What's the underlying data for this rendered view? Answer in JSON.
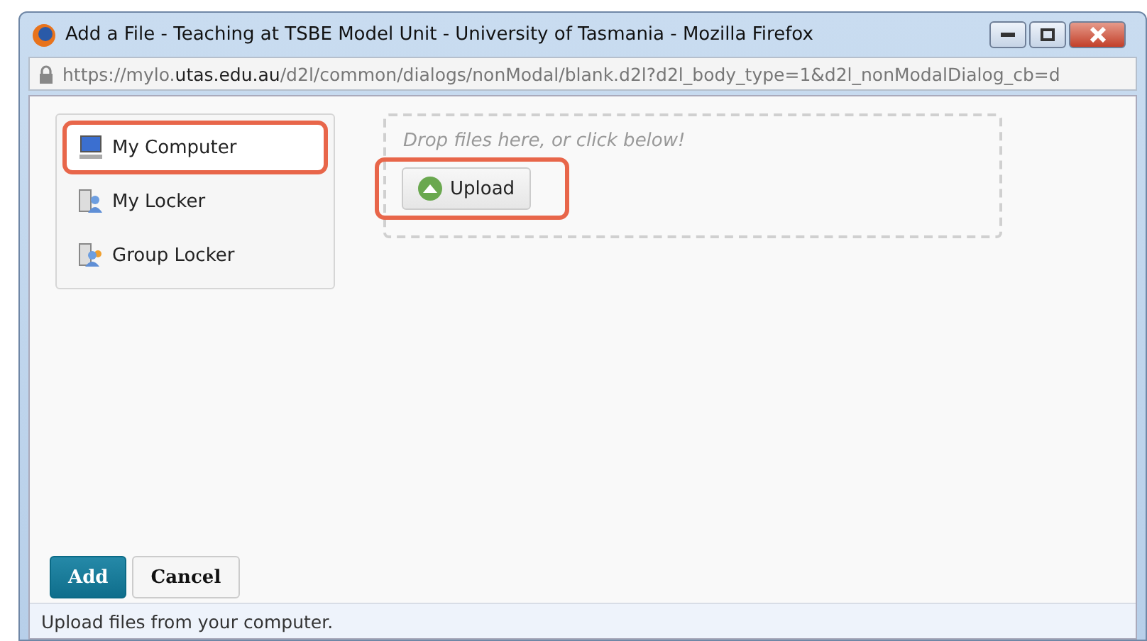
{
  "window": {
    "title": "Add a File - Teaching at TSBE Model Unit - University of Tasmania - Mozilla Firefox"
  },
  "address_bar": {
    "prefix": "https://mylo.",
    "domain": "utas.edu.au",
    "path": "/d2l/common/dialogs/nonModal/blank.d2l?d2l_body_type=1&d2l_nonModalDialog_cb=d"
  },
  "sources": [
    {
      "label": "My Computer",
      "kind": "computer",
      "selected": true
    },
    {
      "label": "My Locker",
      "kind": "locker",
      "selected": false
    },
    {
      "label": "Group Locker",
      "kind": "group",
      "selected": false
    }
  ],
  "drop_zone": {
    "hint": "Drop files here, or click below!",
    "upload": {
      "label": "Upload",
      "highlighted": true
    }
  },
  "buttons": [
    {
      "label": "Add",
      "kind": "primary"
    },
    {
      "label": "Cancel",
      "kind": "secondary"
    }
  ],
  "status_bar": "Upload files from your computer."
}
